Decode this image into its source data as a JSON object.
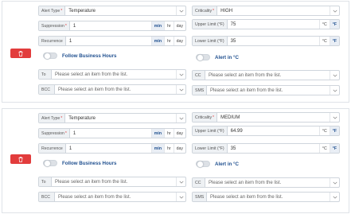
{
  "colors": {
    "delete": "#e23c3c",
    "accent": "#1f4f8f",
    "label_bg": "#eef1f4"
  },
  "icons": {
    "delete": "trash-icon",
    "dropdown": "chevron-down-icon"
  },
  "alerts": [
    {
      "alert_type": {
        "label": "Alert Type",
        "value": "Temperature"
      },
      "suppression": {
        "label": "Suppression",
        "value": "1",
        "units": [
          "min",
          "hr",
          "day"
        ],
        "selected_unit": "min"
      },
      "recurrence": {
        "label": "Recurrence",
        "value": "1",
        "units": [
          "min",
          "hr",
          "day"
        ],
        "selected_unit": "min"
      },
      "follow_business_hours": {
        "label": "Follow Business Hours",
        "on": false
      },
      "to": {
        "label": "To",
        "placeholder": "Please select an item from the list."
      },
      "bcc": {
        "label": "BCC",
        "placeholder": "Please select an item from the list."
      },
      "criticality": {
        "label": "Criticality",
        "value": "HIGH"
      },
      "upper_limit": {
        "label": "Upper Limit (°F)",
        "value": "75",
        "units": [
          "°C",
          "°F"
        ],
        "selected_unit": "°F"
      },
      "lower_limit": {
        "label": "Lower Limit (°F)",
        "value": "35",
        "units": [
          "°C",
          "°F"
        ],
        "selected_unit": "°F"
      },
      "alert_in_c": {
        "label": "Alert in °C",
        "on": false
      },
      "cc": {
        "label": "CC",
        "placeholder": "Please select an item from the list."
      },
      "sms": {
        "label": "SMS",
        "placeholder": "Please select an item from the list."
      }
    },
    {
      "alert_type": {
        "label": "Alert Type",
        "value": "Temperature"
      },
      "suppression": {
        "label": "Suppression",
        "value": "1",
        "units": [
          "min",
          "hr",
          "day"
        ],
        "selected_unit": "min"
      },
      "recurrence": {
        "label": "Recurrence",
        "value": "1",
        "units": [
          "min",
          "hr",
          "day"
        ],
        "selected_unit": "min"
      },
      "follow_business_hours": {
        "label": "Follow Business Hours",
        "on": false
      },
      "to": {
        "label": "To",
        "placeholder": "Please select an item from the list."
      },
      "bcc": {
        "label": "BCC",
        "placeholder": "Please select an item from the list."
      },
      "criticality": {
        "label": "Criticality",
        "value": "MEDIUM"
      },
      "upper_limit": {
        "label": "Upper Limit (°F)",
        "value": "64.99",
        "units": [
          "°C",
          "°F"
        ],
        "selected_unit": "°F"
      },
      "lower_limit": {
        "label": "Lower Limit (°F)",
        "value": "35",
        "units": [
          "°C",
          "°F"
        ],
        "selected_unit": "°F"
      },
      "alert_in_c": {
        "label": "Alert in °C",
        "on": false
      },
      "cc": {
        "label": "CC",
        "placeholder": "Please select an item from the list."
      },
      "sms": {
        "label": "SMS",
        "placeholder": "Please select an item from the list."
      }
    }
  ]
}
